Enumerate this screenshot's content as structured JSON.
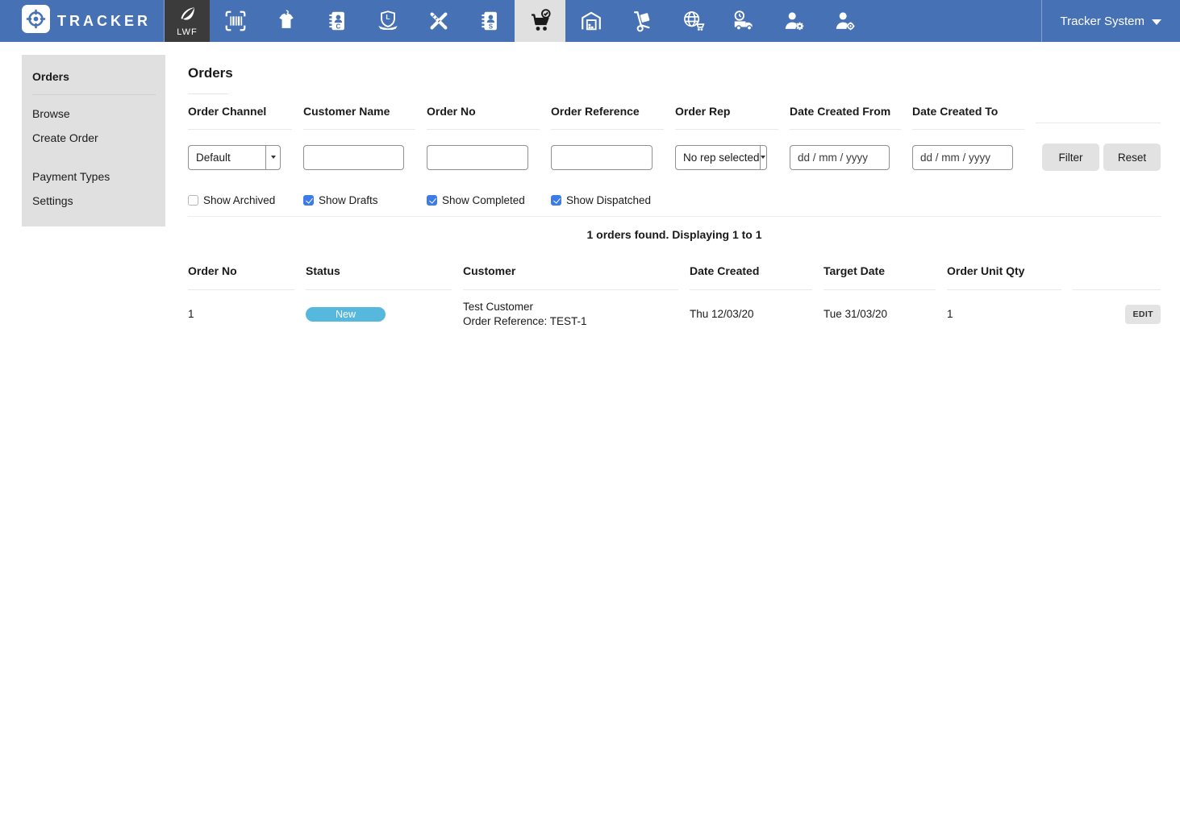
{
  "nav": {
    "brand": "TRACKER",
    "workspace_badge": "LWF",
    "account_label": "Tracker System",
    "icons": [
      "barcode-scan",
      "garments",
      "contacts-customers",
      "brand-shield",
      "design-tools",
      "contacts-suppliers",
      "orders-cart",
      "warehouse",
      "goods-handling",
      "online-store",
      "dispatch-truck",
      "user-admin",
      "user-target"
    ],
    "active_icon": "orders-cart"
  },
  "sidebar": {
    "title": "Orders",
    "items": [
      "Browse",
      "Create Order",
      "Payment Types",
      "Settings"
    ]
  },
  "main": {
    "title": "Orders",
    "filters": {
      "fields": [
        {
          "label": "Order Channel",
          "control": "select",
          "value": "Default"
        },
        {
          "label": "Customer Name",
          "control": "text",
          "value": ""
        },
        {
          "label": "Order No",
          "control": "text",
          "value": ""
        },
        {
          "label": "Order Reference",
          "control": "text",
          "value": ""
        },
        {
          "label": "Order Rep",
          "control": "select",
          "value": "No rep selected"
        },
        {
          "label": "Date Created From",
          "control": "date",
          "value": "dd / mm / yyyy"
        },
        {
          "label": "Date Created To",
          "control": "date",
          "value": "dd / mm / yyyy"
        }
      ],
      "buttons": {
        "filter": "Filter",
        "reset": "Reset"
      },
      "checkboxes": [
        {
          "label": "Show Archived",
          "checked": false
        },
        {
          "label": "Show Drafts",
          "checked": true
        },
        {
          "label": "Show Completed",
          "checked": true
        },
        {
          "label": "Show Dispatched",
          "checked": true
        }
      ]
    },
    "results": {
      "summary": "1 orders found. Displaying 1 to 1",
      "columns": [
        "Order No",
        "Status",
        "Customer",
        "Date Created",
        "Target Date",
        "Order Unit Qty"
      ],
      "rows": [
        {
          "order_no": "1",
          "status": "New",
          "customer_line1": "Test Customer",
          "customer_line2": "Order Reference: TEST-1",
          "date_created": "Thu 12/03/20",
          "target_date": "Tue 31/03/20",
          "order_unit_qty": "1",
          "action": "EDIT"
        }
      ]
    }
  },
  "colors": {
    "nav_bar": "#4671b5",
    "active_tab_bg": "#e0e0e0",
    "sidebar_bg": "#e0e0e0",
    "status_new": "#57b8dd",
    "checkbox_checked": "#3d7ce8",
    "button_bg": "#e2e2e2"
  }
}
